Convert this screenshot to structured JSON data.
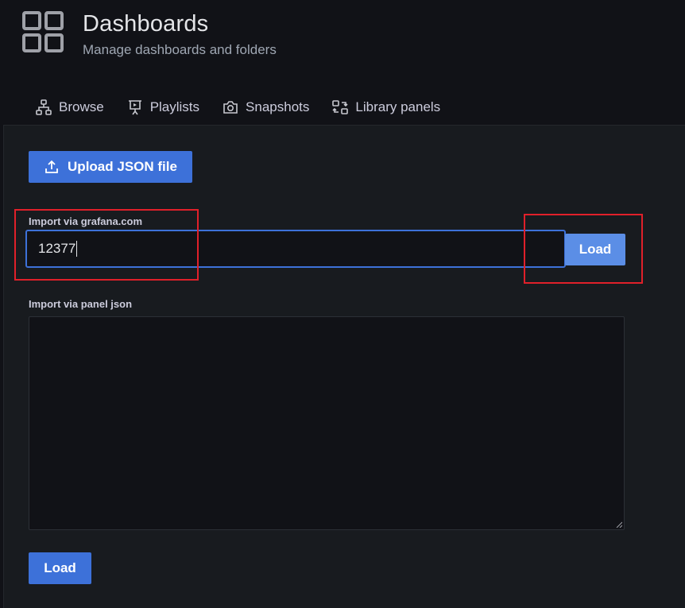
{
  "header": {
    "title": "Dashboards",
    "subtitle": "Manage dashboards and folders",
    "icon": "apps-grid-icon"
  },
  "tabs": [
    {
      "label": "Browse",
      "icon": "sitemap-icon"
    },
    {
      "label": "Playlists",
      "icon": "presentation-icon"
    },
    {
      "label": "Snapshots",
      "icon": "camera-icon"
    },
    {
      "label": "Library panels",
      "icon": "library-panel-icon"
    }
  ],
  "import": {
    "upload_label": "Upload JSON file",
    "gcom_label": "Import via grafana.com",
    "gcom_value": "12377",
    "gcom_load_label": "Load",
    "json_label": "Import via panel json",
    "json_value": "",
    "load_label": "Load"
  },
  "colors": {
    "primary": "#3d71d9",
    "annotation": "#e0202a",
    "background": "#111217",
    "panel": "#181b1f"
  }
}
